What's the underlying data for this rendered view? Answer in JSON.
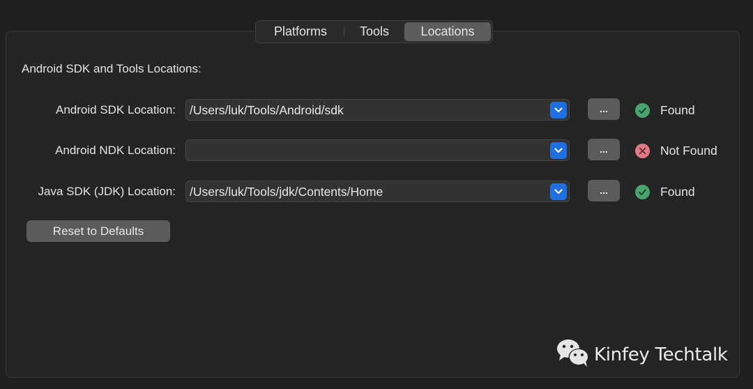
{
  "tabs": [
    {
      "label": "Platforms",
      "selected": false
    },
    {
      "label": "Tools",
      "selected": false
    },
    {
      "label": "Locations",
      "selected": true
    }
  ],
  "section_title": "Android SDK and Tools Locations:",
  "locations": [
    {
      "label": "Android SDK Location:",
      "value": "/Users/luk/Tools/Android/sdk",
      "browse_label": "...",
      "status": "Found",
      "status_icon": "check-circle-icon"
    },
    {
      "label": "Android NDK Location:",
      "value": "",
      "browse_label": "...",
      "status": "Not Found",
      "status_icon": "x-circle-icon"
    },
    {
      "label": "Java SDK (JDK) Location:",
      "value": "/Users/luk/Tools/jdk/Contents/Home",
      "browse_label": "...",
      "status": "Found",
      "status_icon": "check-circle-icon"
    }
  ],
  "reset_label": "Reset to Defaults",
  "watermark": {
    "icon": "wechat-icon",
    "text": "Kinfey Techtalk"
  },
  "colors": {
    "accent": "#1f6fe0",
    "found": "#4aa46e",
    "not_found": "#e07a86"
  }
}
